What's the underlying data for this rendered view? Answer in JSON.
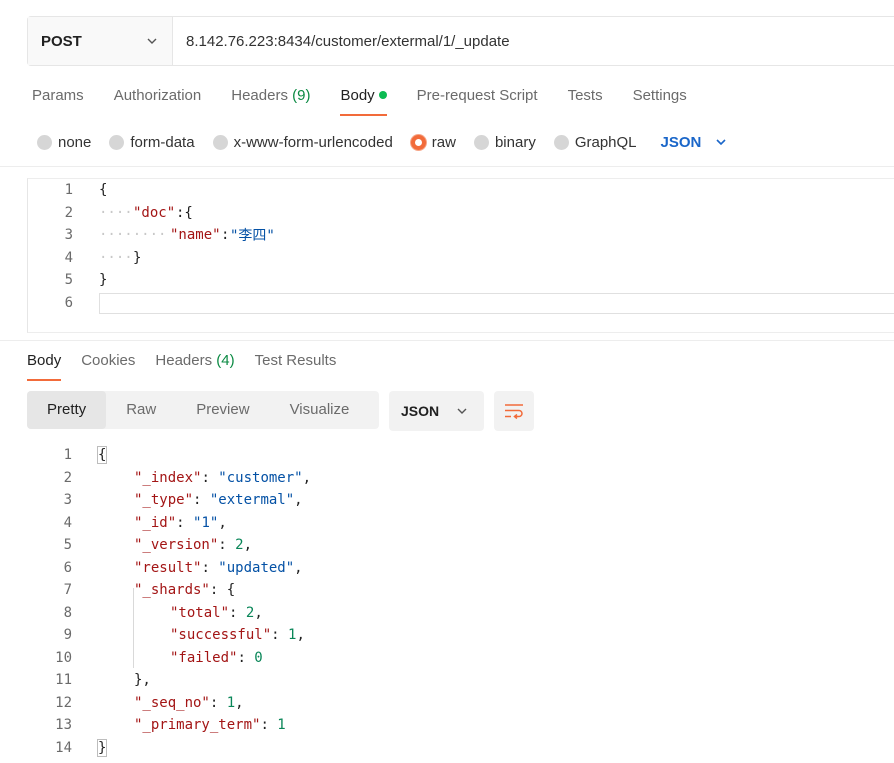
{
  "request": {
    "method": "POST",
    "url": "8.142.76.223:8434/customer/extermal/1/_update"
  },
  "request_tabs": {
    "params": "Params",
    "authorization": "Authorization",
    "headers": "Headers",
    "headers_count": "(9)",
    "body": "Body",
    "prerequest": "Pre-request Script",
    "tests": "Tests",
    "settings": "Settings"
  },
  "body_types": {
    "none": "none",
    "form_data": "form-data",
    "urlencoded": "x-www-form-urlencoded",
    "raw": "raw",
    "binary": "binary",
    "graphql": "GraphQL",
    "selected": "raw",
    "language": "JSON"
  },
  "request_body_lines": [
    {
      "n": "1",
      "text": "{"
    },
    {
      "n": "2",
      "key": "\"doc\"",
      "rest": ":{"
    },
    {
      "n": "3",
      "key": "\"name\"",
      "colon": ":",
      "str": "\"李四\""
    },
    {
      "n": "4",
      "text": "}"
    },
    {
      "n": "5",
      "text": "}"
    },
    {
      "n": "6",
      "text": ""
    }
  ],
  "response_tabs": {
    "body": "Body",
    "cookies": "Cookies",
    "headers": "Headers",
    "headers_count": "(4)",
    "test_results": "Test Results"
  },
  "view_modes": {
    "pretty": "Pretty",
    "raw": "Raw",
    "preview": "Preview",
    "visualize": "Visualize",
    "selected": "Pretty",
    "language": "JSON"
  },
  "response_lines": [
    {
      "n": "1"
    },
    {
      "n": "2"
    },
    {
      "n": "3"
    },
    {
      "n": "4"
    },
    {
      "n": "5"
    },
    {
      "n": "6"
    },
    {
      "n": "7"
    },
    {
      "n": "8"
    },
    {
      "n": "9"
    },
    {
      "n": "10"
    },
    {
      "n": "11"
    },
    {
      "n": "12"
    },
    {
      "n": "13"
    },
    {
      "n": "14"
    }
  ],
  "response": {
    "index_key": "\"_index\"",
    "index_val": "\"customer\"",
    "type_key": "\"_type\"",
    "type_val": "\"extermal\"",
    "id_key": "\"_id\"",
    "id_val": "\"1\"",
    "version_key": "\"_version\"",
    "version_val": "2",
    "result_key": "\"result\"",
    "result_val": "\"updated\"",
    "shards_key": "\"_shards\"",
    "total_key": "\"total\"",
    "total_val": "2",
    "successful_key": "\"successful\"",
    "successful_val": "1",
    "failed_key": "\"failed\"",
    "failed_val": "0",
    "seq_key": "\"_seq_no\"",
    "seq_val": "1",
    "term_key": "\"_primary_term\"",
    "term_val": "1"
  },
  "colors": {
    "accent": "#f26b3a",
    "count_green": "#0b8a43",
    "link_blue": "#1a66c9",
    "json_key": "#a31515",
    "json_string": "#0451a5",
    "json_number": "#098658"
  }
}
